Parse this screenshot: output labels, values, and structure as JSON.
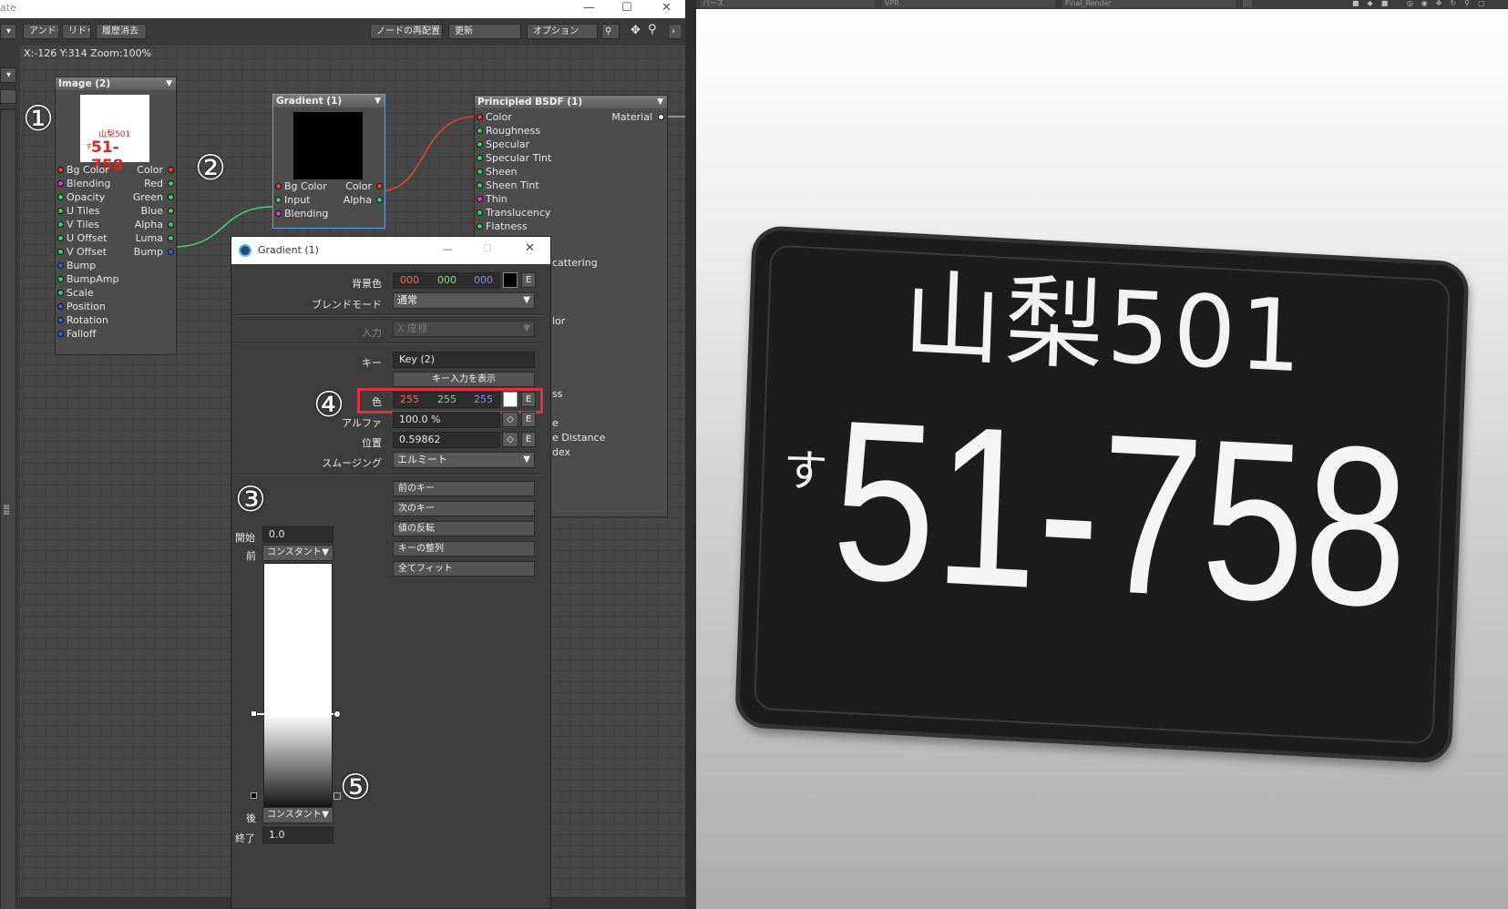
{
  "window": {
    "title_fragment": "ate"
  },
  "toolbar": {
    "undo": "アンドゥ",
    "redo": "リドゥ",
    "clear_history": "履歴消去",
    "rearrange_nodes": "ノードの再配置",
    "update": "更新",
    "options": "オプション"
  },
  "status": {
    "coords": "X:-126 Y:314 Zoom:100%"
  },
  "nodes": {
    "image": {
      "title": "Image (2)",
      "plate_top": "山梨501",
      "plate_small": "す",
      "plate_main": "51-758",
      "inputs": [
        "Bg Color",
        "Blending",
        "Opacity",
        "U Tiles",
        "V Tiles",
        "U Offset",
        "V Offset",
        "Bump",
        "BumpAmp",
        "Scale",
        "Position",
        "Rotation",
        "Falloff"
      ],
      "outputs": [
        "Color",
        "Red",
        "Green",
        "Blue",
        "Alpha",
        "Luma",
        "Bump"
      ]
    },
    "gradient": {
      "title": "Gradient (1)",
      "inputs": [
        "Bg Color",
        "Input",
        "Blending"
      ],
      "outputs": [
        "Color",
        "Alpha"
      ]
    },
    "bsdf": {
      "title": "Principled BSDF (1)",
      "output": "Material",
      "inputs": [
        "Color",
        "Roughness",
        "Specular",
        "Specular Tint",
        "Sheen",
        "Sheen Tint",
        "Thin",
        "Translucency",
        "Flatness"
      ],
      "partial_labels": [
        "cattering",
        "lor",
        "ss",
        "e",
        "e Distance",
        "dex"
      ]
    }
  },
  "annotations": {
    "n1": "①",
    "n2": "②",
    "n3": "③",
    "n4": "④",
    "n5": "⑤"
  },
  "dialog": {
    "title": "Gradient (1)",
    "bg_color_label": "背景色",
    "bg_r": "000",
    "bg_g": "000",
    "bg_b": "000",
    "e": "E",
    "blend_mode_label": "ブレンドモード",
    "blend_mode_value": "通常",
    "input_label": "入力",
    "input_value": "X 座標",
    "key_label": "キー",
    "key_value": "Key (2)",
    "show_key_input": "キー入力を表示",
    "color_label": "色",
    "color_r": "255",
    "color_g": "255",
    "color_b": "255",
    "alpha_label": "アルファ",
    "alpha_value": "100.0 %",
    "position_label": "位置",
    "position_value": "0.59862",
    "smoothing_label": "スムージング",
    "smoothing_value": "エルミート",
    "prev_key": "前のキー",
    "next_key": "次のキー",
    "invert_values": "値の反転",
    "align_keys": "キーの整列",
    "fit_all": "全てフィット",
    "start_label": "開始",
    "start_value": "0.0",
    "pre_label": "前",
    "pre_value": "コンスタント",
    "post_label": "後",
    "post_value": "コンスタント",
    "end_label": "終了",
    "end_value": "1.0",
    "key_position_fraction": 0.59862
  },
  "viewport": {
    "selectors": [
      "パース",
      "VPR",
      "Final_Render"
    ],
    "plate_top": "山梨501",
    "plate_small": "す",
    "plate_main": "51-758"
  },
  "colors": {
    "accent_red": "#e0313f",
    "port_red": "#e8452a",
    "port_green": "#2fd36a",
    "port_magenta": "#d43fc8",
    "port_blue": "#3a5de0",
    "wire_red": "#e8452a",
    "wire_green": "#3ed86e"
  },
  "icons": [
    "chevron-down-icon",
    "pin-icon",
    "move-icon",
    "search-icon",
    "chevron-right-icon",
    "minimize-icon",
    "maximize-icon",
    "close-icon",
    "app-icon",
    "spinner-arrows-icon"
  ]
}
